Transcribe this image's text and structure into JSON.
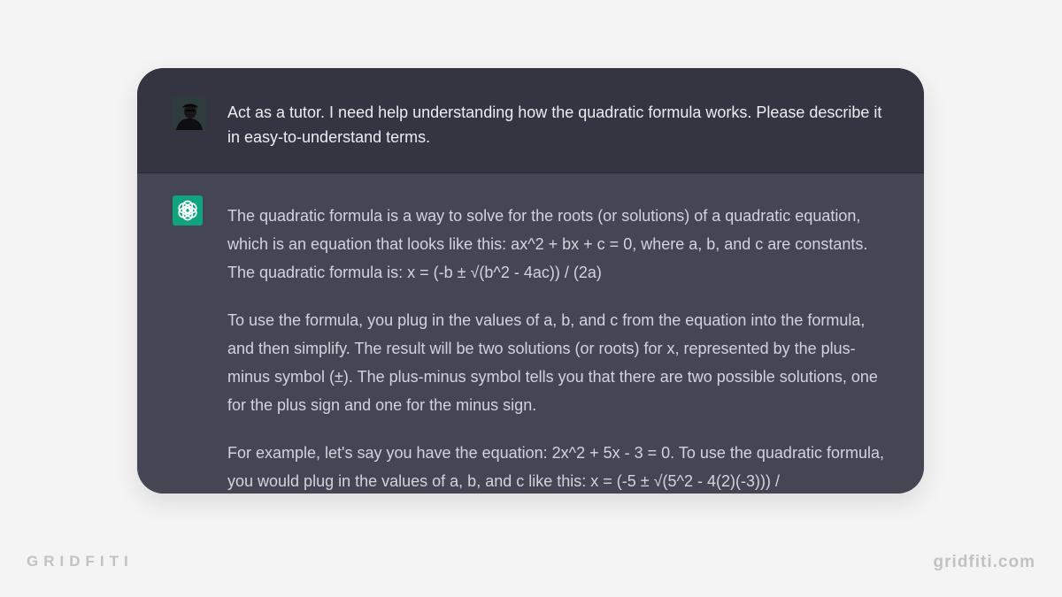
{
  "conversation": {
    "user_message": "Act as a tutor. I need help understanding how the quadratic formula works. Please describe it in easy-to-understand terms.",
    "assistant_paragraphs": [
      "The quadratic formula is a way to solve for the roots (or solutions) of a quadratic equation, which is an equation that looks like this: ax^2 + bx + c = 0, where a, b, and c are constants. The quadratic formula is: x = (-b ± √(b^2 - 4ac)) / (2a)",
      "To use the formula, you plug in the values of a, b, and c from the equation into the formula, and then simplify. The result will be two solutions (or roots) for x, represented by the plus-minus symbol (±). The plus-minus symbol tells you that there are two possible solutions, one for the plus sign and one for the minus sign.",
      "For example, let's say you have the equation: 2x^2 + 5x - 3 = 0. To use the quadratic formula, you would plug in the values of a, b, and c like this: x = (-5 ± √(5^2 - 4(2)(-3))) /"
    ]
  },
  "branding": {
    "left_logo": "GRIDFITI",
    "right_url": "gridfiti.com"
  },
  "colors": {
    "page_background": "#f4f4f4",
    "user_row": "#343541",
    "assistant_row": "#444654",
    "assistant_logo": "#10a37f",
    "text": "#ececf1"
  },
  "icons": {
    "user_avatar": "user-avatar-photo",
    "assistant_logo": "openai-logo-icon"
  }
}
